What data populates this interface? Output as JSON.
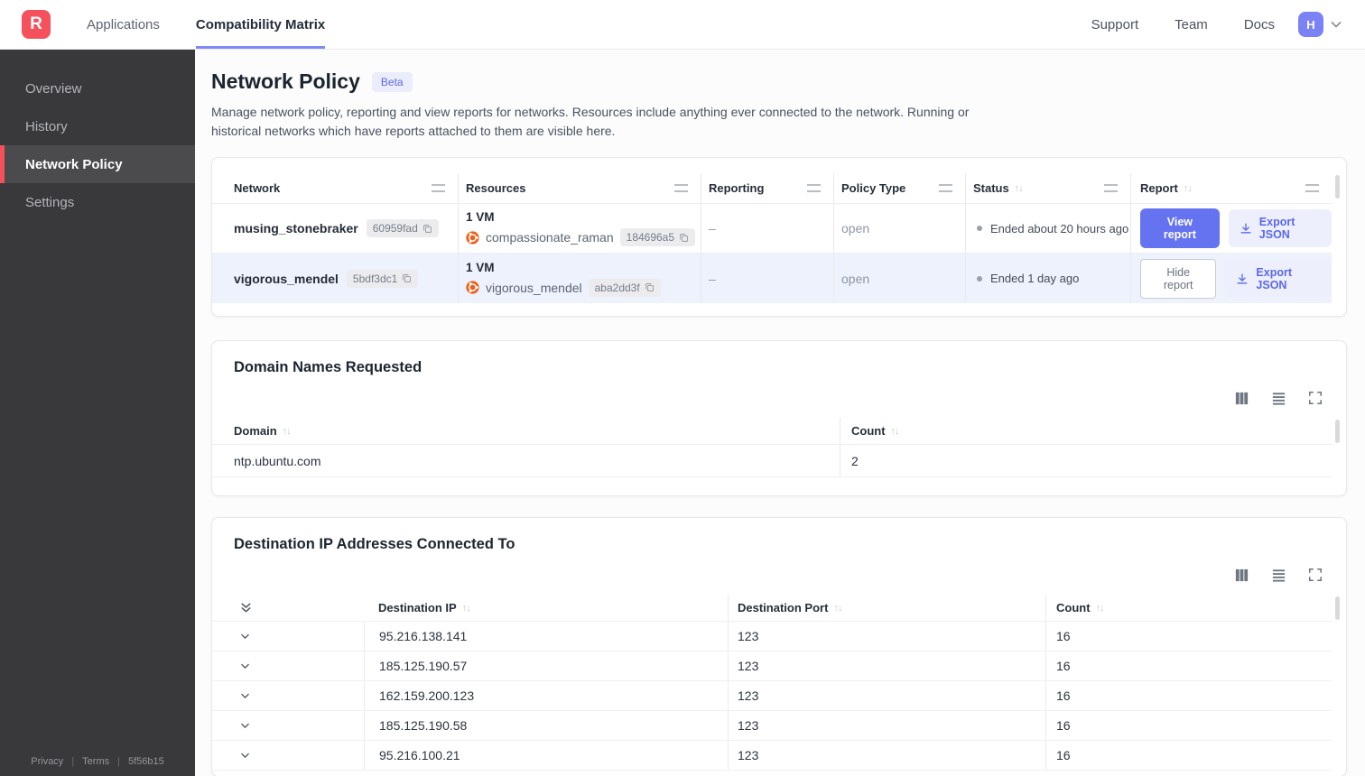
{
  "colors": {
    "brand_red": "#f5515c",
    "accent_indigo": "#6673f0",
    "highlight_row": "#edf2fc"
  },
  "nav": {
    "logo_letter": "R",
    "tabs": [
      {
        "label": "Applications"
      },
      {
        "label": "Compatibility Matrix"
      }
    ],
    "links": [
      {
        "label": "Support"
      },
      {
        "label": "Team"
      },
      {
        "label": "Docs"
      }
    ],
    "avatar_initial": "H"
  },
  "sidebar": {
    "items": [
      {
        "label": "Overview"
      },
      {
        "label": "History"
      },
      {
        "label": "Network Policy"
      },
      {
        "label": "Settings"
      }
    ],
    "footer": {
      "privacy": "Privacy",
      "terms": "Terms",
      "version": "5f56b15"
    }
  },
  "page": {
    "title": "Network Policy",
    "badge": "Beta",
    "description": "Manage network policy, reporting and view reports for networks. Resources include anything ever connected to the network. Running or historical networks which have reports attached to them are visible here."
  },
  "network_table": {
    "headers": {
      "network": "Network",
      "resources": "Resources",
      "reporting": "Reporting",
      "policy_type": "Policy Type",
      "status": "Status",
      "report": "Report"
    },
    "rows": [
      {
        "name": "musing_stonebraker",
        "id": "60959fad",
        "vm_count": "1 VM",
        "resource_name": "compassionate_raman",
        "resource_id": "184696a5",
        "reporting": "–",
        "policy_type": "open",
        "status": "Ended about 20 hours ago",
        "report_action": "View report",
        "export_action": "Export JSON"
      },
      {
        "name": "vigorous_mendel",
        "id": "5bdf3dc1",
        "vm_count": "1 VM",
        "resource_name": "vigorous_mendel",
        "resource_id": "aba2dd3f",
        "reporting": "–",
        "policy_type": "open",
        "status": "Ended 1 day ago",
        "report_action": "Hide report",
        "export_action": "Export JSON"
      }
    ]
  },
  "domains": {
    "title": "Domain Names Requested",
    "headers": {
      "domain": "Domain",
      "count": "Count"
    },
    "rows": [
      {
        "domain": "ntp.ubuntu.com",
        "count": "2"
      }
    ]
  },
  "destinations": {
    "title": "Destination IP Addresses Connected To",
    "headers": {
      "ip": "Destination IP",
      "port": "Destination Port",
      "count": "Count"
    },
    "rows": [
      {
        "ip": "95.216.138.141",
        "port": "123",
        "count": "16"
      },
      {
        "ip": "185.125.190.57",
        "port": "123",
        "count": "16"
      },
      {
        "ip": "162.159.200.123",
        "port": "123",
        "count": "16"
      },
      {
        "ip": "185.125.190.58",
        "port": "123",
        "count": "16"
      },
      {
        "ip": "95.216.100.21",
        "port": "123",
        "count": "16"
      }
    ]
  }
}
